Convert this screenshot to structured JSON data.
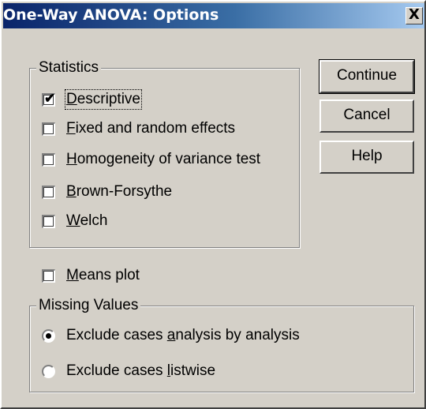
{
  "window": {
    "title": "One-Way ANOVA: Options",
    "close_symbol": "X"
  },
  "statistics": {
    "legend": "Statistics",
    "items": [
      {
        "pre": "",
        "key": "D",
        "post": "escriptive",
        "checked": true
      },
      {
        "pre": "",
        "key": "F",
        "post": "ixed and random effects",
        "checked": false
      },
      {
        "pre": "",
        "key": "H",
        "post": "omogeneity of variance test",
        "checked": false
      },
      {
        "pre": "",
        "key": "B",
        "post": "rown-Forsythe",
        "checked": false
      },
      {
        "pre": "",
        "key": "W",
        "post": "elch",
        "checked": false
      }
    ]
  },
  "means_plot": {
    "pre": "",
    "key": "M",
    "post": "eans plot",
    "checked": false
  },
  "missing_values": {
    "legend": "Missing Values",
    "options": [
      {
        "pre": "Exclude cases ",
        "key": "a",
        "post": "nalysis by analysis",
        "selected": true
      },
      {
        "pre": "Exclude cases ",
        "key": "l",
        "post": "istwise",
        "selected": false
      }
    ]
  },
  "buttons": {
    "continue": "Continue",
    "cancel": "Cancel",
    "help": "Help"
  },
  "colors": {
    "face": "#d4d0c8",
    "title_start": "#0a246a",
    "title_end": "#a6caf0"
  }
}
